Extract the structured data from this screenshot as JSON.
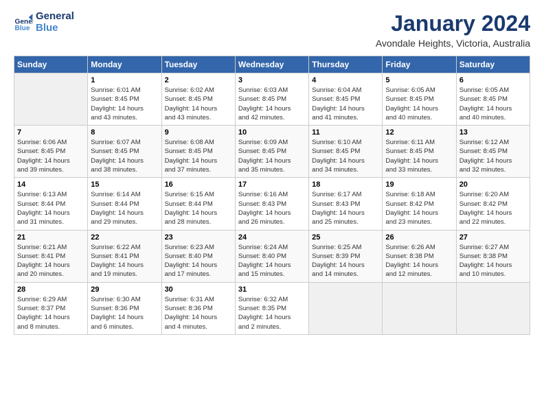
{
  "logo": {
    "line1": "General",
    "line2": "Blue"
  },
  "title": "January 2024",
  "subtitle": "Avondale Heights, Victoria, Australia",
  "header_days": [
    "Sunday",
    "Monday",
    "Tuesday",
    "Wednesday",
    "Thursday",
    "Friday",
    "Saturday"
  ],
  "weeks": [
    [
      {
        "day": "",
        "info": ""
      },
      {
        "day": "1",
        "info": "Sunrise: 6:01 AM\nSunset: 8:45 PM\nDaylight: 14 hours\nand 43 minutes."
      },
      {
        "day": "2",
        "info": "Sunrise: 6:02 AM\nSunset: 8:45 PM\nDaylight: 14 hours\nand 43 minutes."
      },
      {
        "day": "3",
        "info": "Sunrise: 6:03 AM\nSunset: 8:45 PM\nDaylight: 14 hours\nand 42 minutes."
      },
      {
        "day": "4",
        "info": "Sunrise: 6:04 AM\nSunset: 8:45 PM\nDaylight: 14 hours\nand 41 minutes."
      },
      {
        "day": "5",
        "info": "Sunrise: 6:05 AM\nSunset: 8:45 PM\nDaylight: 14 hours\nand 40 minutes."
      },
      {
        "day": "6",
        "info": "Sunrise: 6:05 AM\nSunset: 8:45 PM\nDaylight: 14 hours\nand 40 minutes."
      }
    ],
    [
      {
        "day": "7",
        "info": "Sunrise: 6:06 AM\nSunset: 8:45 PM\nDaylight: 14 hours\nand 39 minutes."
      },
      {
        "day": "8",
        "info": "Sunrise: 6:07 AM\nSunset: 8:45 PM\nDaylight: 14 hours\nand 38 minutes."
      },
      {
        "day": "9",
        "info": "Sunrise: 6:08 AM\nSunset: 8:45 PM\nDaylight: 14 hours\nand 37 minutes."
      },
      {
        "day": "10",
        "info": "Sunrise: 6:09 AM\nSunset: 8:45 PM\nDaylight: 14 hours\nand 35 minutes."
      },
      {
        "day": "11",
        "info": "Sunrise: 6:10 AM\nSunset: 8:45 PM\nDaylight: 14 hours\nand 34 minutes."
      },
      {
        "day": "12",
        "info": "Sunrise: 6:11 AM\nSunset: 8:45 PM\nDaylight: 14 hours\nand 33 minutes."
      },
      {
        "day": "13",
        "info": "Sunrise: 6:12 AM\nSunset: 8:45 PM\nDaylight: 14 hours\nand 32 minutes."
      }
    ],
    [
      {
        "day": "14",
        "info": "Sunrise: 6:13 AM\nSunset: 8:44 PM\nDaylight: 14 hours\nand 31 minutes."
      },
      {
        "day": "15",
        "info": "Sunrise: 6:14 AM\nSunset: 8:44 PM\nDaylight: 14 hours\nand 29 minutes."
      },
      {
        "day": "16",
        "info": "Sunrise: 6:15 AM\nSunset: 8:44 PM\nDaylight: 14 hours\nand 28 minutes."
      },
      {
        "day": "17",
        "info": "Sunrise: 6:16 AM\nSunset: 8:43 PM\nDaylight: 14 hours\nand 26 minutes."
      },
      {
        "day": "18",
        "info": "Sunrise: 6:17 AM\nSunset: 8:43 PM\nDaylight: 14 hours\nand 25 minutes."
      },
      {
        "day": "19",
        "info": "Sunrise: 6:18 AM\nSunset: 8:42 PM\nDaylight: 14 hours\nand 23 minutes."
      },
      {
        "day": "20",
        "info": "Sunrise: 6:20 AM\nSunset: 8:42 PM\nDaylight: 14 hours\nand 22 minutes."
      }
    ],
    [
      {
        "day": "21",
        "info": "Sunrise: 6:21 AM\nSunset: 8:41 PM\nDaylight: 14 hours\nand 20 minutes."
      },
      {
        "day": "22",
        "info": "Sunrise: 6:22 AM\nSunset: 8:41 PM\nDaylight: 14 hours\nand 19 minutes."
      },
      {
        "day": "23",
        "info": "Sunrise: 6:23 AM\nSunset: 8:40 PM\nDaylight: 14 hours\nand 17 minutes."
      },
      {
        "day": "24",
        "info": "Sunrise: 6:24 AM\nSunset: 8:40 PM\nDaylight: 14 hours\nand 15 minutes."
      },
      {
        "day": "25",
        "info": "Sunrise: 6:25 AM\nSunset: 8:39 PM\nDaylight: 14 hours\nand 14 minutes."
      },
      {
        "day": "26",
        "info": "Sunrise: 6:26 AM\nSunset: 8:38 PM\nDaylight: 14 hours\nand 12 minutes."
      },
      {
        "day": "27",
        "info": "Sunrise: 6:27 AM\nSunset: 8:38 PM\nDaylight: 14 hours\nand 10 minutes."
      }
    ],
    [
      {
        "day": "28",
        "info": "Sunrise: 6:29 AM\nSunset: 8:37 PM\nDaylight: 14 hours\nand 8 minutes."
      },
      {
        "day": "29",
        "info": "Sunrise: 6:30 AM\nSunset: 8:36 PM\nDaylight: 14 hours\nand 6 minutes."
      },
      {
        "day": "30",
        "info": "Sunrise: 6:31 AM\nSunset: 8:36 PM\nDaylight: 14 hours\nand 4 minutes."
      },
      {
        "day": "31",
        "info": "Sunrise: 6:32 AM\nSunset: 8:35 PM\nDaylight: 14 hours\nand 2 minutes."
      },
      {
        "day": "",
        "info": ""
      },
      {
        "day": "",
        "info": ""
      },
      {
        "day": "",
        "info": ""
      }
    ]
  ]
}
